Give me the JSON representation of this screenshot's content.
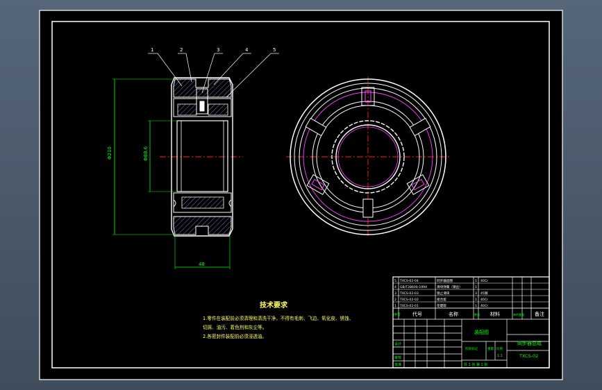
{
  "drawing": {
    "balloons": [
      "1",
      "2",
      "3",
      "4",
      "5"
    ],
    "dimensions": {
      "overall_height": "Φ210",
      "bore": "Φ88.6",
      "width": "48"
    },
    "tech_requirements": {
      "title": "技术要求",
      "line1": "1.零件在装配前必须清理和清洗干净，不得有毛刺、飞边、氧化皮、锈蚀、",
      "line2": "切屑、油污、着色剂和灰尘等。",
      "line3": "2.各密封件装配前必须浸透油。"
    },
    "title_block": {
      "parts_table": [
        {
          "no": "5",
          "code": "TXCS-02-04",
          "name": "同步器齿圈",
          "qty": "1",
          "material": "40Cr"
        },
        {
          "no": "4",
          "code": "GB/T28600-1994",
          "name": "滑块弹簧（钢丝）",
          "qty": "1",
          "material": ""
        },
        {
          "no": "3",
          "code": "TXCS-02-03",
          "name": "锁止滑块",
          "qty": "3",
          "material": "45钢"
        },
        {
          "no": "2",
          "code": "TXCS-02-02",
          "name": "接合套",
          "qty": "1",
          "material": "40Cr"
        },
        {
          "no": "1",
          "code": "TXCS-02-01",
          "name": "花键毂",
          "qty": "1",
          "material": "40Cr"
        }
      ],
      "header": {
        "no": "序号",
        "code": "代号",
        "name": "名称",
        "qty": "数量",
        "material": "材料",
        "weight": "单件重量",
        "remark": "备注"
      },
      "assembly_name": "装配图",
      "product_name": "同步器总成",
      "drawing_code": "TXCS-02",
      "scale_label": "比例",
      "scale_value": "1:1",
      "sheet_info": "共 1 张  第 1 张",
      "revision_label": "阶段标记",
      "weight_label": "重量",
      "designer_label": "设计",
      "checker_label": "审核",
      "approver_label": "批准"
    }
  },
  "colors": {
    "background": "#000000",
    "frame": "#ffffff",
    "outline": "#ffffff",
    "hatch": "#9c9cff",
    "centerline": "#ff2020",
    "dimension": "#00ff00",
    "text": "#ffff66",
    "titleblock_text": "#00ff00",
    "inner_circle": "#ff40ff",
    "leader": "#ffffff"
  }
}
